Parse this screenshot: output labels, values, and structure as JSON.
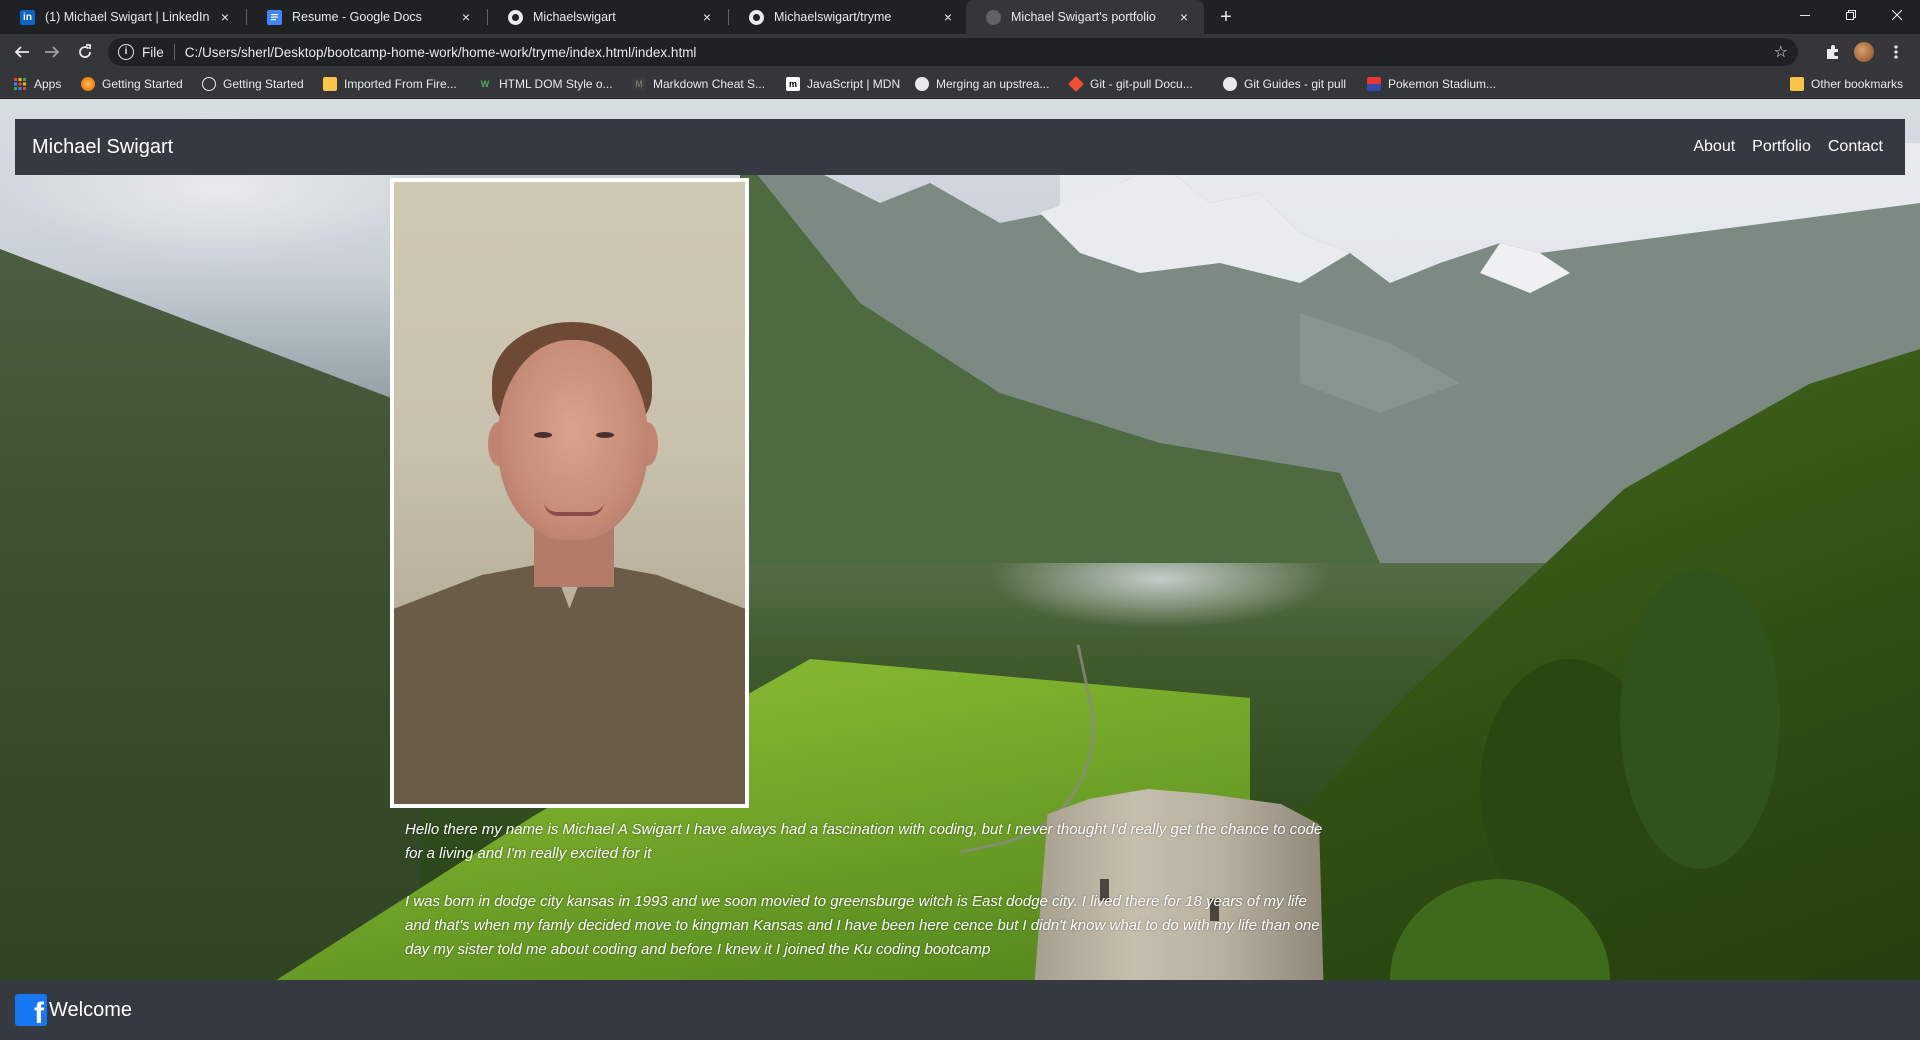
{
  "browser": {
    "tabs": [
      {
        "title": "(1) Michael Swigart | LinkedIn",
        "icon": "linkedin-icon",
        "active": false
      },
      {
        "title": "Resume - Google Docs",
        "icon": "google-docs-icon",
        "active": false
      },
      {
        "title": "Michaelswigart",
        "icon": "github-icon",
        "active": false
      },
      {
        "title": "Michaelswigart/tryme",
        "icon": "github-icon",
        "active": false
      },
      {
        "title": "Michael Swigart's portfolio",
        "icon": "globe-icon",
        "active": true
      }
    ],
    "new_tab": "+",
    "close_glyph": "×",
    "omnibox": {
      "scheme_label": "File",
      "url": "C:/Users/sherl/Desktop/bootcamp-home-work/home-work/tryme/index.html/index.html"
    },
    "bookmarks": [
      {
        "label": "Apps",
        "icon": "apps-grid-icon"
      },
      {
        "label": "Getting Started",
        "icon": "firefox-icon"
      },
      {
        "label": "Getting Started",
        "icon": "globe-icon"
      },
      {
        "label": "Imported From Fire...",
        "icon": "folder-icon"
      },
      {
        "label": "HTML DOM Style o...",
        "icon": "w3schools-icon"
      },
      {
        "label": "Markdown Cheat S...",
        "icon": "markdown-icon"
      },
      {
        "label": "JavaScript | MDN",
        "icon": "mdn-icon"
      },
      {
        "label": "Merging an upstrea...",
        "icon": "github-icon"
      },
      {
        "label": "Git - git-pull Docu...",
        "icon": "git-icon"
      },
      {
        "label": "Git Guides - git pull",
        "icon": "github-icon"
      },
      {
        "label": "Pokemon Stadium...",
        "icon": "pokemon-icon"
      }
    ],
    "other_bookmarks": "Other bookmarks"
  },
  "site": {
    "brand": "Michael Swigart",
    "nav": [
      "About",
      "Portfolio",
      "Contact"
    ],
    "bio": [
      "Hello there my name is Michael A Swigart I have always had a fascination with coding, but I never thought I'd really get the chance to code for a living and I'm really excited for it",
      "I was born in dodge city kansas in 1993 and we soon movied to greensburge witch is East dodge city. I lived there for 18 years of my life and that's when my famly decided move to kingman Kansas and I have been here cence but I didn't know what to do with my life than one day my sister told me about coding and before I knew it I joined the Ku coding bootcamp"
    ],
    "footer": {
      "text": "Welcome",
      "icon": "facebook-icon"
    }
  },
  "colors": {
    "chrome_dark": "#202124",
    "chrome_toolbar": "#35363a",
    "navbar": "#343a40",
    "facebook_blue": "#1877f2"
  }
}
